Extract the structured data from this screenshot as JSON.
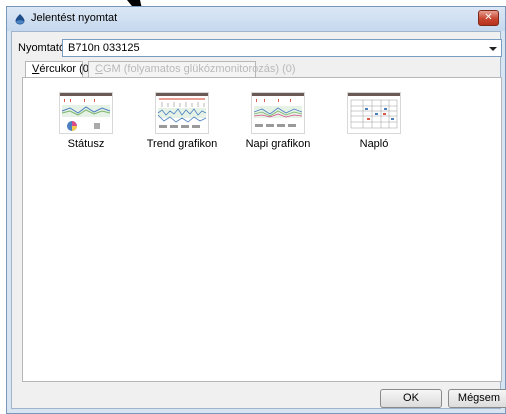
{
  "window": {
    "title": "Jelentést nyomtat"
  },
  "printer": {
    "label": "Nyomtató:",
    "value": "B710n 033125"
  },
  "tabs": [
    {
      "label": "Vércukor (0)",
      "active": true
    },
    {
      "label": "CGM (folyamatos glükózmonitorozás) (0)",
      "active": false
    }
  ],
  "reports": [
    {
      "label": "Státusz",
      "thumb": "status-report-thumbnail"
    },
    {
      "label": "Trend grafikon",
      "thumb": "trend-chart-thumbnail"
    },
    {
      "label": "Napi grafikon",
      "thumb": "daily-chart-thumbnail"
    },
    {
      "label": "Napló",
      "thumb": "logbook-thumbnail"
    }
  ],
  "buttons": {
    "ok": "OK",
    "cancel": "Mégsem"
  },
  "colors": {
    "titlebar": "#c6d8ee",
    "close": "#c7452f",
    "thumb_header": "#6b5a55"
  }
}
